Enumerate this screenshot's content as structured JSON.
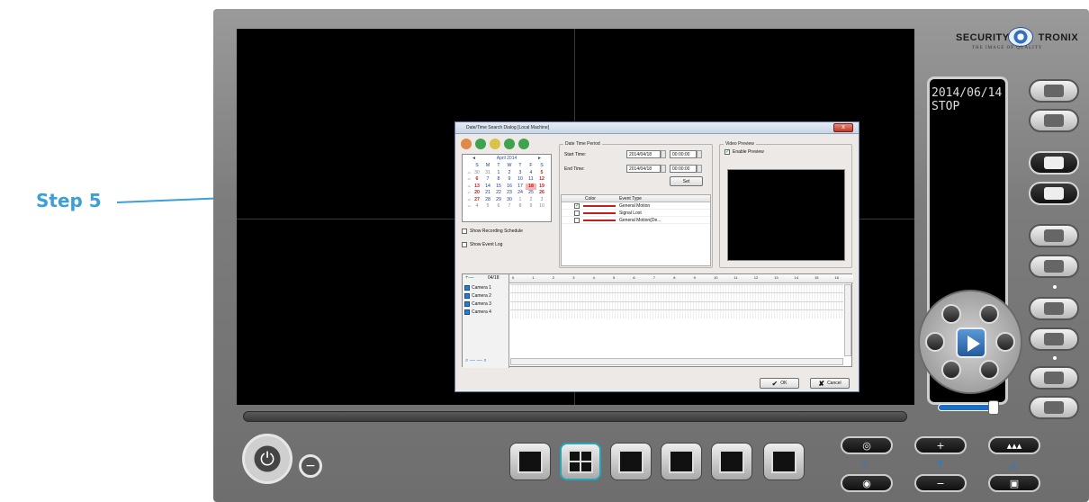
{
  "annotation": {
    "step_label": "Step 5"
  },
  "brand": {
    "name": "SECURITY",
    "name_suffix": "TRONIX",
    "tagline": "THE IMAGE OF QUALITY"
  },
  "osd": {
    "date": "2014/06/14",
    "status": "STOP"
  },
  "dialog": {
    "title": "Date/Time Search Dialog [Local Machine]",
    "close_label": "x",
    "calendar": {
      "month_label": "April 2014",
      "prev_label": "◄",
      "next_label": "►",
      "day_headers": [
        "S",
        "M",
        "T",
        "W",
        "T",
        "F",
        "S"
      ],
      "weeks": [
        {
          "wk": "14",
          "days": [
            "30",
            "31",
            "1",
            "2",
            "3",
            "4",
            "5"
          ]
        },
        {
          "wk": "15",
          "days": [
            "6",
            "7",
            "8",
            "9",
            "10",
            "11",
            "12"
          ]
        },
        {
          "wk": "16",
          "days": [
            "13",
            "14",
            "15",
            "16",
            "17",
            "18",
            "19"
          ]
        },
        {
          "wk": "17",
          "days": [
            "20",
            "21",
            "22",
            "23",
            "24",
            "25",
            "26"
          ]
        },
        {
          "wk": "18",
          "days": [
            "27",
            "28",
            "29",
            "30",
            "1",
            "2",
            "3"
          ]
        },
        {
          "wk": "19",
          "days": [
            "4",
            "5",
            "6",
            "7",
            "8",
            "9",
            "10"
          ]
        }
      ],
      "selected_day": "18"
    },
    "show_recording_schedule": "Show Recording Schedule",
    "show_event_log": "Show Event Log",
    "date_time_period": {
      "group_title": "Date Time Period",
      "start_label": "Start Time:",
      "start_date": "2014/04/18",
      "start_time": "00:00:00",
      "end_label": "End Time:",
      "end_date": "2014/04/18",
      "end_time": "00:00:00",
      "set_label": "Set"
    },
    "event_table": {
      "col_color": "Color",
      "col_type": "Event Type",
      "rows": [
        {
          "checked": true,
          "type": "General Motion"
        },
        {
          "checked": false,
          "type": "Signal Lost"
        },
        {
          "checked": false,
          "type": "General Motion(De..."
        }
      ]
    },
    "video_preview": {
      "group_title": "Video Preview",
      "enable_label": "Enable Preview",
      "enabled": true
    },
    "timeline": {
      "date_label": "04/18",
      "cameras": [
        "Camera 1",
        "Camera 2",
        "Camera 3",
        "Camera 4"
      ],
      "hours": [
        "0",
        "1",
        "2",
        "3",
        "4",
        "5",
        "6",
        "7",
        "8",
        "9",
        "10",
        "11",
        "12",
        "13",
        "14",
        "15",
        "16"
      ]
    },
    "ok_label": "OK",
    "cancel_label": "Cancel"
  },
  "colors": {
    "accent": "#3aa0dc",
    "event_line": "#c0201a",
    "play": "#245a9a"
  }
}
